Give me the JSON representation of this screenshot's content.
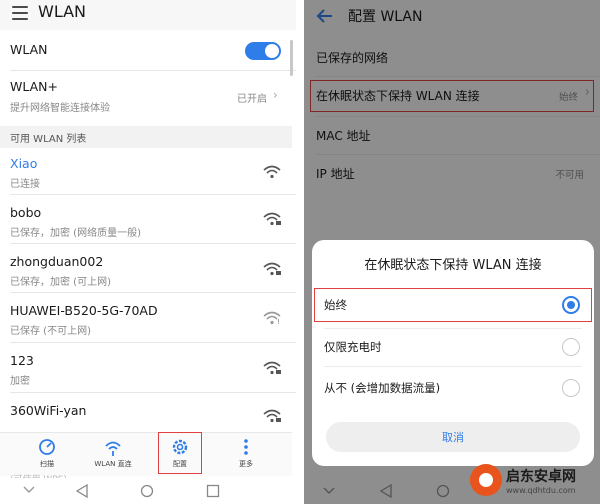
{
  "left": {
    "title": "WLAN",
    "wlan_label": "WLAN",
    "wlan_plus": {
      "title": "WLAN+",
      "subtitle": "提升网络智能连接体验",
      "state": "已开启"
    },
    "section_header": "可用 WLAN 列表",
    "networks": [
      {
        "name": "Xiao",
        "status": "已连接",
        "connected": true
      },
      {
        "name": "bobo",
        "status": "已保存，加密 (网络质量一般)",
        "connected": false
      },
      {
        "name": "zhongduan002",
        "status": "已保存，加密 (可上网)",
        "connected": false
      },
      {
        "name": "HUAWEI-B520-5G-70AD",
        "status": "已保存 (不可上网)",
        "connected": false
      },
      {
        "name": "123",
        "status": "加密",
        "connected": false
      },
      {
        "name": "360WiFi-yan",
        "status": "加密",
        "connected": false
      }
    ],
    "bottom_bar": [
      {
        "label": "扫描",
        "icon": "refresh-icon"
      },
      {
        "label": "WLAN 直连",
        "icon": "wifi-direct-icon"
      },
      {
        "label": "配置",
        "icon": "gear-icon"
      },
      {
        "label": "更多",
        "icon": "more-icon"
      }
    ],
    "hidden_row_text": "(可使用 WPS)"
  },
  "right": {
    "title": "配置 WLAN",
    "rows": [
      {
        "title": "已保存的网络",
        "value": ""
      },
      {
        "title": "在休眠状态下保持 WLAN 连接",
        "value": "始终"
      },
      {
        "title": "MAC 地址",
        "value": ""
      },
      {
        "title": "IP 地址",
        "value": "不可用"
      }
    ],
    "dialog": {
      "title": "在休眠状态下保持 WLAN 连接",
      "options": [
        {
          "label": "始终",
          "selected": true
        },
        {
          "label": "仅限充电时",
          "selected": false
        },
        {
          "label": "从不 (会增加数据流量)",
          "selected": false
        }
      ],
      "cancel": "取消"
    }
  },
  "watermark": {
    "title": "启东安卓网",
    "url": "www.qdhtdu.com"
  },
  "colors": {
    "accent": "#2f7de8",
    "highlight_box": "#e04040"
  }
}
